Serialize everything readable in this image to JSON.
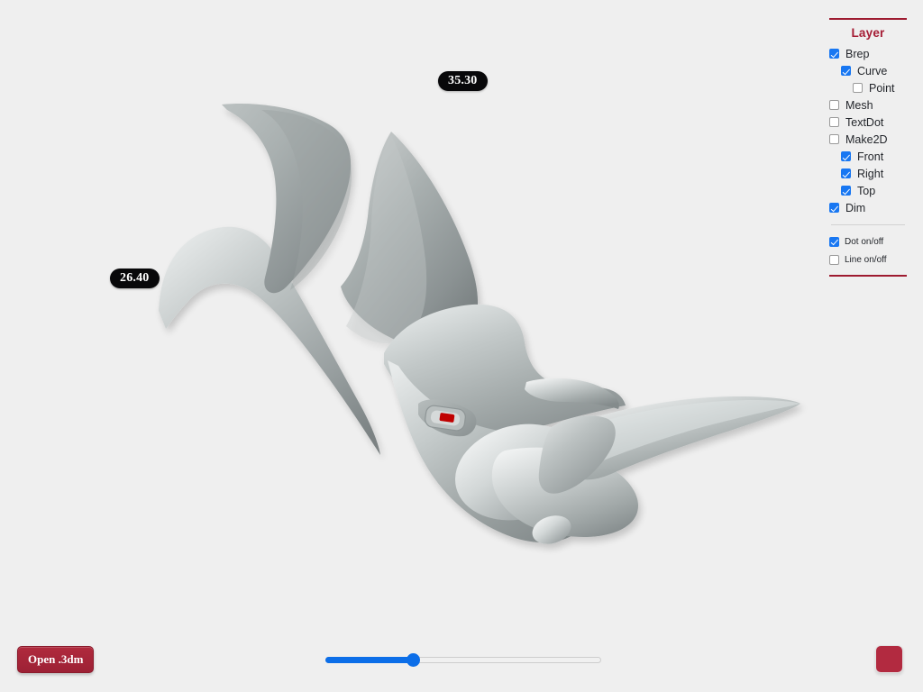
{
  "viewport": {
    "background_color": "#efefef",
    "model_name": "rhino-head-nurbs-model",
    "surface_color": "#9aa0a0",
    "highlight_color": "#e9ebeb",
    "shadow_color": "#6f7576",
    "eye_marker_color": "#c00000"
  },
  "dimension_dots": [
    {
      "value": "35.30"
    },
    {
      "value": "26.40"
    }
  ],
  "layer_panel": {
    "title": "Layer",
    "accent_color": "#a51c34",
    "checkbox_on_color": "#1877f2",
    "items": [
      {
        "label": "Brep",
        "checked": true,
        "indent": 0,
        "name": "layer-brep"
      },
      {
        "label": "Curve",
        "checked": true,
        "indent": 1,
        "name": "layer-curve"
      },
      {
        "label": "Point",
        "checked": false,
        "indent": 2,
        "name": "layer-point"
      },
      {
        "label": "Mesh",
        "checked": false,
        "indent": 0,
        "name": "layer-mesh"
      },
      {
        "label": "TextDot",
        "checked": false,
        "indent": 0,
        "name": "layer-textdot"
      },
      {
        "label": "Make2D",
        "checked": false,
        "indent": 0,
        "name": "layer-make2d"
      },
      {
        "label": "Front",
        "checked": true,
        "indent": 1,
        "name": "layer-front"
      },
      {
        "label": "Right",
        "checked": true,
        "indent": 1,
        "name": "layer-right"
      },
      {
        "label": "Top",
        "checked": true,
        "indent": 1,
        "name": "layer-top"
      },
      {
        "label": "Dim",
        "checked": true,
        "indent": 0,
        "name": "layer-dim"
      }
    ],
    "toggles": [
      {
        "label": "Dot on/off",
        "checked": true,
        "name": "toggle-dot-on-off"
      },
      {
        "label": "Line on/off",
        "checked": false,
        "name": "toggle-line-on-off"
      }
    ]
  },
  "controls": {
    "open_button_label": "Open .3dm",
    "open_button_color": "#a5233a",
    "slider": {
      "value_percent": 31,
      "fill_color": "#0c6ee8",
      "track_color": "#f0f0f0"
    },
    "color_swatch": {
      "color": "#b22a40"
    }
  }
}
